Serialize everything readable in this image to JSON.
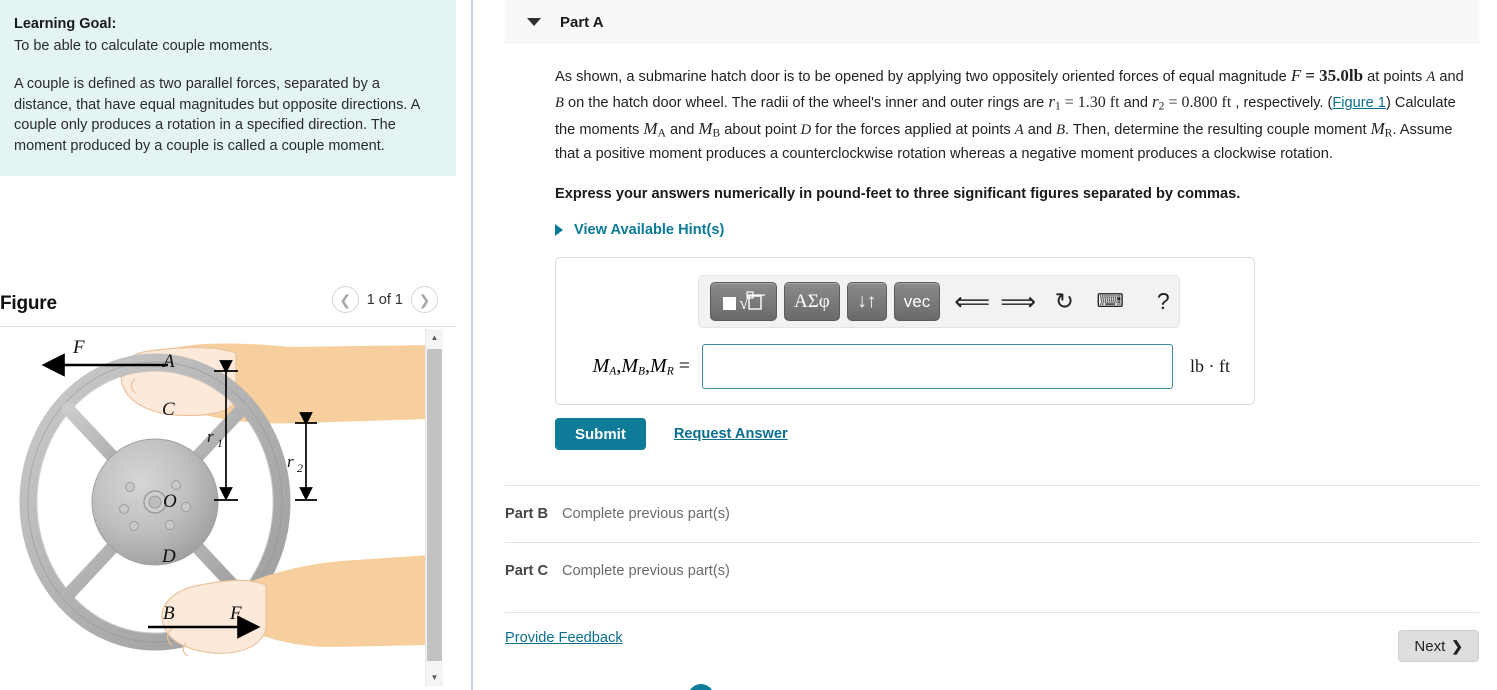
{
  "left_panel": {
    "learning_goal_title": "Learning Goal:",
    "learning_goal_sub": "To be able to calculate couple moments.",
    "learning_goal_body": "A couple is defined as two parallel forces, separated by a distance, that have equal magnitudes but opposite directions. A couple only produces a rotation in a specified direction. The moment produced by a couple is called a couple moment.",
    "figure_title": "Figure",
    "figure_counter": "1 of 1",
    "prev_icon": "chevron-left-icon",
    "next_icon": "chevron-right-icon",
    "bg_color": "#e4f4f4"
  },
  "figure": {
    "labels": {
      "force_top": "F",
      "force_bottom": "F",
      "point_a": "A",
      "point_b": "B",
      "point_c": "C",
      "point_d": "D",
      "center_o": "O",
      "radius_inner": "r",
      "radius_inner_sub": "1",
      "radius_outer": "r",
      "radius_outer_sub": "2"
    },
    "colors": {
      "wheel": "#b4b4b4",
      "hub": "#b8b8b8",
      "arm": "#f7cf9e",
      "hand": "#fde9d9"
    }
  },
  "part_a": {
    "caret_icon": "caret-down-icon",
    "label": "Part A",
    "problem": {
      "t1": "As shown, a submarine hatch door is to be opened by applying two oppositely oriented forces of equal magnitude ",
      "F_sym": "F",
      "F_eq": "=",
      "F_val": "35.0lb",
      "t2": " at points ",
      "pt_a": "A",
      "t3": " and ",
      "pt_b": "B",
      "t4": " on the hatch door wheel.  The radii of the wheel's inner and outer rings are ",
      "r1_sym": "r",
      "r1_sub": "1",
      "r1_val": "= 1.30 ft",
      "t5": " and ",
      "r2_sym": "r",
      "r2_sub": "2",
      "r2_val": "= 0.800 ft",
      "t6": " , respectively. (",
      "figure_link": "Figure 1",
      "t7": ") Calculate the moments ",
      "MA_sym": "M",
      "MA_sub": "A",
      "t8": " and ",
      "MB_sym": "M",
      "MB_sub": "B",
      "t9": " about point ",
      "pt_d": "D",
      "t10": " for the forces applied at points ",
      "pt_a2": "A",
      "t11": " and ",
      "pt_b2": "B",
      "t12": ". Then, determine the resulting couple moment ",
      "MR_sym": "M",
      "MR_sub": "R",
      "t13": ". Assume that a positive moment produces a counterclockwise rotation whereas a negative moment produces a clockwise rotation."
    },
    "express_instruction": "Express your answers numerically in pound-feet to three significant figures separated by commas.",
    "hints_label": "View Available Hint(s)",
    "hints_caret_icon": "caret-right-icon",
    "toolbar": {
      "template_button": "template-icon",
      "greek_button": "ΑΣφ",
      "arrows_button": "↓↑",
      "vec_button": "vec",
      "undo_icon": "undo-icon",
      "redo_icon": "redo-icon",
      "reset_icon": "reset-icon",
      "keyboard_icon": "keyboard-icon",
      "help_icon": "help-icon"
    },
    "answer": {
      "label_M": "M",
      "label_A": "A",
      "label_B": "B",
      "label_R": "R",
      "label_comma": ",",
      "label_eq": "=",
      "value": "",
      "placeholder": "",
      "units": "lb · ft",
      "border_color": "#3b8ba5"
    },
    "submit_label": "Submit",
    "submit_color": "#0e7c98",
    "request_answer_label": "Request Answer"
  },
  "part_b": {
    "label": "Part B",
    "status": "Complete previous part(s)"
  },
  "part_c": {
    "label": "Part C",
    "status": "Complete previous part(s)"
  },
  "footer": {
    "feedback_label": "Provide Feedback",
    "next_label": "Next",
    "next_chevron": "chevron-right-icon"
  }
}
